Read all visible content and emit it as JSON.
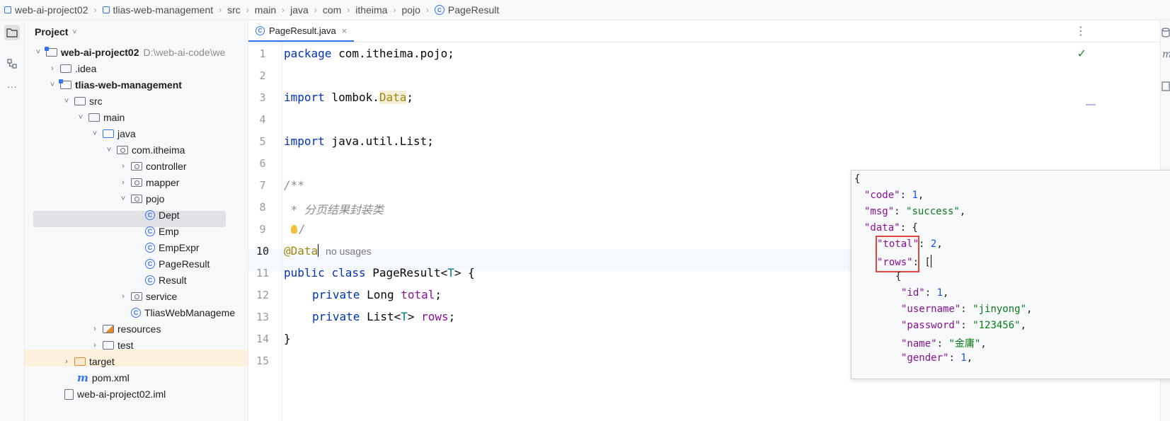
{
  "breadcrumb": [
    "web-ai-project02",
    "tlias-web-management",
    "src",
    "main",
    "java",
    "com",
    "itheima",
    "pojo",
    "PageResult"
  ],
  "project_panel": {
    "title": "Project",
    "tree": [
      {
        "label": "web-ai-project02",
        "path": "D:\\web-ai-code\\we",
        "arrow": "˅",
        "icon": "module",
        "bold": true
      },
      {
        "label": ".idea",
        "arrow": "›",
        "icon": "folder"
      },
      {
        "label": "tlias-web-management",
        "arrow": "˅",
        "icon": "module",
        "bold": true
      },
      {
        "label": "src",
        "arrow": "˅",
        "icon": "folder"
      },
      {
        "label": "main",
        "arrow": "˅",
        "icon": "folder"
      },
      {
        "label": "java",
        "arrow": "˅",
        "icon": "folder-blue"
      },
      {
        "label": "com.itheima",
        "arrow": "˅",
        "icon": "package"
      },
      {
        "label": "controller",
        "arrow": "›",
        "icon": "package"
      },
      {
        "label": "mapper",
        "arrow": "›",
        "icon": "package"
      },
      {
        "label": "pojo",
        "arrow": "˅",
        "icon": "package",
        "selected": true
      },
      {
        "label": "Dept",
        "icon": "class"
      },
      {
        "label": "Emp",
        "icon": "class"
      },
      {
        "label": "EmpExpr",
        "icon": "class"
      },
      {
        "label": "PageResult",
        "icon": "class"
      },
      {
        "label": "Result",
        "icon": "class"
      },
      {
        "label": "service",
        "arrow": "›",
        "icon": "package"
      },
      {
        "label": "TliasWebManageme",
        "icon": "spring-class"
      },
      {
        "label": "resources",
        "arrow": "›",
        "icon": "resources-folder"
      },
      {
        "label": "test",
        "arrow": "›",
        "icon": "folder"
      },
      {
        "label": "target",
        "arrow": "›",
        "icon": "folder-orange"
      },
      {
        "label": "pom.xml",
        "icon": "maven"
      },
      {
        "label": "web-ai-project02.iml",
        "icon": "file"
      }
    ]
  },
  "editor": {
    "tab_label": "PageResult.java",
    "close_glyph": "×",
    "menu_glyph": "⋮",
    "check_glyph": "✓",
    "line_numbers": [
      "1",
      "2",
      "3",
      "4",
      "5",
      "6",
      "7",
      "8",
      "9",
      "10",
      "11",
      "12",
      "13",
      "14",
      "15"
    ],
    "code": {
      "l1_kw": "package",
      "l1_rest": " com.itheima.pojo;",
      "l3_kw": "import",
      "l3_pre": " lombok.",
      "l3_ann": "Data",
      "l3_end": ";",
      "l5_kw": "import",
      "l5_rest": " java.util.List;",
      "l7": "/**",
      "l8": " * 分页结果封装类",
      "l9": "/",
      "l10_ann": "@Data",
      "l10_hint": "no usages",
      "l11_kw1": "public",
      "l11_kw2": "class",
      "l11_name": " PageResult<",
      "l11_tp": "T",
      "l11_end": "> {",
      "l12_kw": "private",
      "l12_type": " Long ",
      "l12_fld": "total",
      "l12_end": ";",
      "l13_kw": "private",
      "l13_type": " List<",
      "l13_tp": "T",
      "l13_mid": "> ",
      "l13_fld": "rows",
      "l13_end": ";",
      "l14": "}"
    }
  },
  "json_popup": {
    "open": "{",
    "code_key": "\"code\"",
    "code_val": "1",
    "msg_key": "\"msg\"",
    "msg_val": "\"success\"",
    "data_key": "\"data\"",
    "total_key": "\"total\"",
    "total_val": "2",
    "rows_key": "\"rows\"",
    "inner_open": "{",
    "id_key": "\"id\"",
    "id_val": "1",
    "username_key": "\"username\"",
    "username_val": "\"jinyong\"",
    "password_key": "\"password\"",
    "password_val": "\"123456\"",
    "name_key": "\"name\"",
    "name_val": "\"金庸\"",
    "gender_key": "\"gender\"",
    "gender_val": "1"
  }
}
